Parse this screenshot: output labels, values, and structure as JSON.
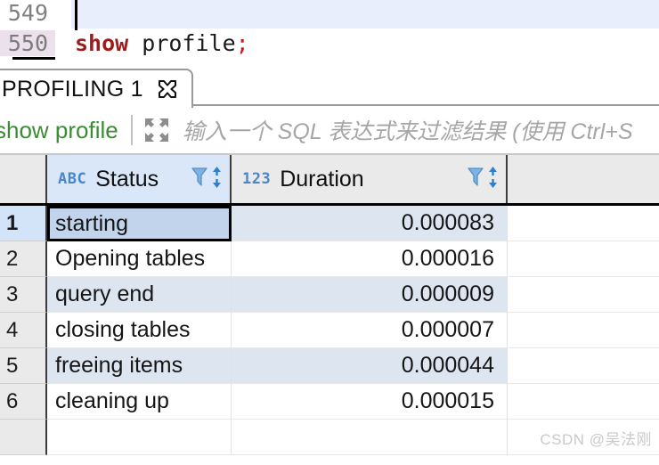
{
  "editor": {
    "lines": [
      {
        "number": "549",
        "code_plain": "",
        "current": false
      },
      {
        "number": "550",
        "code_keyword": "show",
        "code_rest": " profile",
        "code_punct": ";",
        "current": true
      }
    ]
  },
  "tab": {
    "label": "PROFILING 1",
    "close_icon": "close-x-icon"
  },
  "filterbar": {
    "query_label": "show profile",
    "expand_icon": "expand-arrows-icon",
    "placeholder": "输入一个 SQL 表达式来过滤结果 (使用 Ctrl+S"
  },
  "grid": {
    "columns": [
      {
        "type_badge": "ABC",
        "label": "Status",
        "type": "text",
        "selected": true
      },
      {
        "type_badge": "123",
        "label": "Duration",
        "type": "number",
        "selected": false
      }
    ],
    "column_icons": {
      "filter": "filter-funnel-icon",
      "sort": "sort-arrows-icon"
    },
    "rows": [
      {
        "num": "1",
        "status": "starting",
        "duration": "0.000083",
        "selected": true,
        "shade": "odd"
      },
      {
        "num": "2",
        "status": "Opening tables",
        "duration": "0.000016",
        "selected": false,
        "shade": "even"
      },
      {
        "num": "3",
        "status": "query end",
        "duration": "0.000009",
        "selected": false,
        "shade": "odd"
      },
      {
        "num": "4",
        "status": "closing tables",
        "duration": "0.000007",
        "selected": false,
        "shade": "even"
      },
      {
        "num": "5",
        "status": "freeing items",
        "duration": "0.000044",
        "selected": false,
        "shade": "odd"
      },
      {
        "num": "6",
        "status": "cleaning up",
        "duration": "0.000015",
        "selected": false,
        "shade": "even"
      },
      {
        "num": "",
        "status": "",
        "duration": "",
        "selected": false,
        "shade": "even"
      }
    ]
  },
  "watermark": {
    "text": "CSDN @吴法刚"
  },
  "colors": {
    "accent_blue": "#4a86c8",
    "selection_blue": "#c2d4ec",
    "row_shade": "#dde5f1",
    "keyword_red": "#9c1c1c",
    "punct_red": "#d41717",
    "query_green": "#3d8b36",
    "header_gray": "#eaeaea"
  }
}
